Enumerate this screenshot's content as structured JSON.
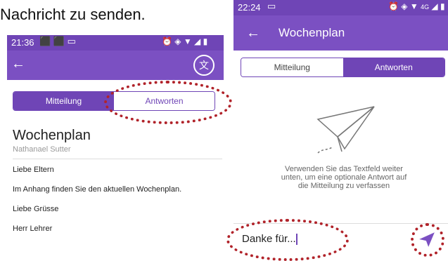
{
  "caption": "Nachricht zu senden.",
  "left": {
    "status_time": "21:36",
    "back_icon": "arrow-left-icon",
    "translate_icon": "translate-icon",
    "tabs": [
      "Mitteilung",
      "Antworten"
    ],
    "title": "Wochenplan",
    "author": "Nathanael Sutter",
    "body_lines": [
      "Liebe Eltern",
      "Im Anhang finden Sie den aktuellen Wochenplan.",
      "Liebe Grüsse",
      "Herr Lehrer"
    ]
  },
  "right": {
    "status_time": "22:24",
    "status_network": "4G",
    "title": "Wochenplan",
    "tabs": [
      "Mitteilung",
      "Antworten"
    ],
    "hint": "Verwenden Sie das Textfeld weiter unten, um eine optionale Antwort auf die Mitteilung zu verfassen",
    "input_value": "Danke für...",
    "send_icon": "send-icon"
  },
  "colors": {
    "brand": "#7b50c2",
    "brand_dark": "#6f45b6",
    "annotation": "#b1232a"
  }
}
